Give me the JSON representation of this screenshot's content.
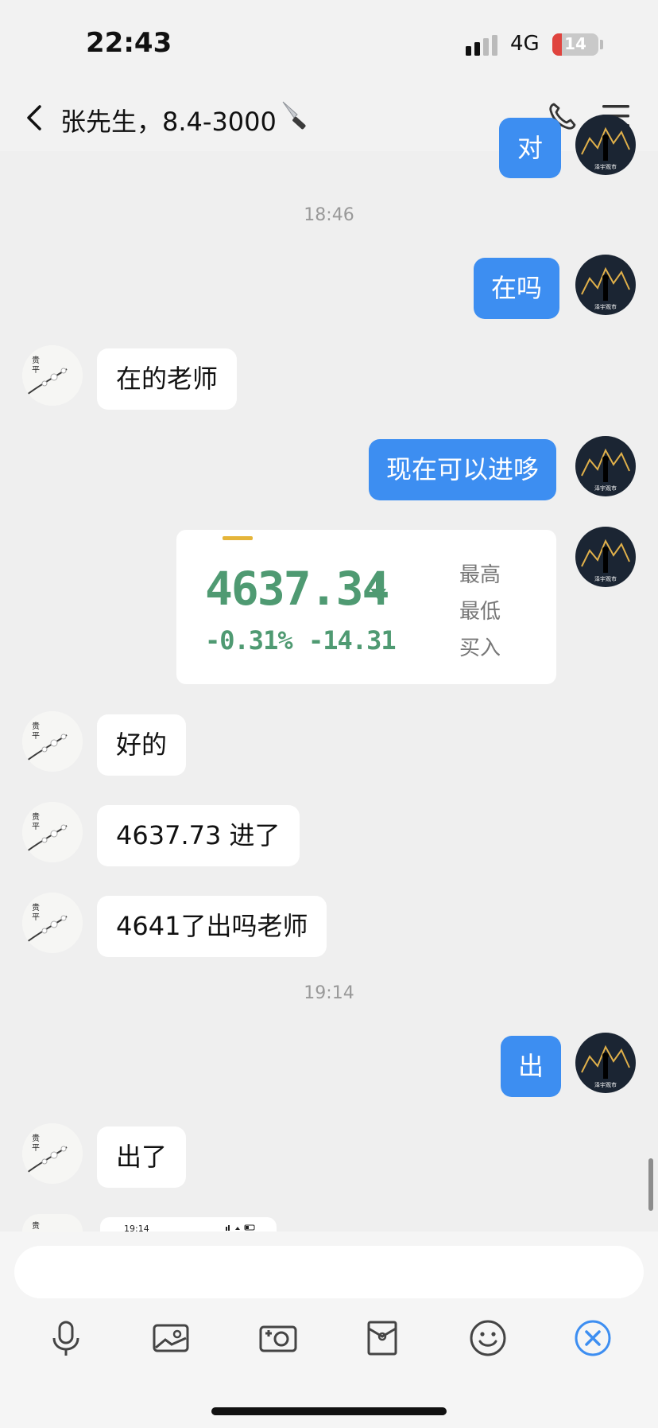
{
  "status_bar": {
    "time": "22:43",
    "network": "4G",
    "battery": "14"
  },
  "header": {
    "title": "张先生，8.4-3000"
  },
  "messages": [
    {
      "side": "right",
      "text": "对"
    },
    {
      "side": "center",
      "text": "18:46"
    },
    {
      "side": "right",
      "text": "在吗"
    },
    {
      "side": "left",
      "text": "在的老师"
    },
    {
      "side": "right",
      "text": "现在可以进哆"
    },
    {
      "side": "left",
      "text": "好的"
    },
    {
      "side": "left",
      "text": "4637.73 进了"
    },
    {
      "side": "left",
      "text": "4641了出吗老师"
    },
    {
      "side": "center",
      "text": "19:14"
    },
    {
      "side": "right",
      "text": "出"
    },
    {
      "side": "left",
      "text": "出了"
    }
  ],
  "stock_card": {
    "price": "4637.34",
    "change_pct": "-0.31%",
    "change": "-14.31",
    "labels": [
      "最高",
      "最低",
      "买入"
    ],
    "color": "#4f9a72"
  },
  "screenshot_preview": {
    "time": "19:14"
  },
  "input": {
    "placeholder": ""
  },
  "toolbar": [
    "microphone-icon",
    "photo-icon",
    "camera-icon",
    "red-packet-icon",
    "emoji-icon",
    "close-circle-icon"
  ],
  "colors": {
    "accent": "#3d8ef1",
    "bubble_in": "#ffffff",
    "background": "#efefef"
  }
}
